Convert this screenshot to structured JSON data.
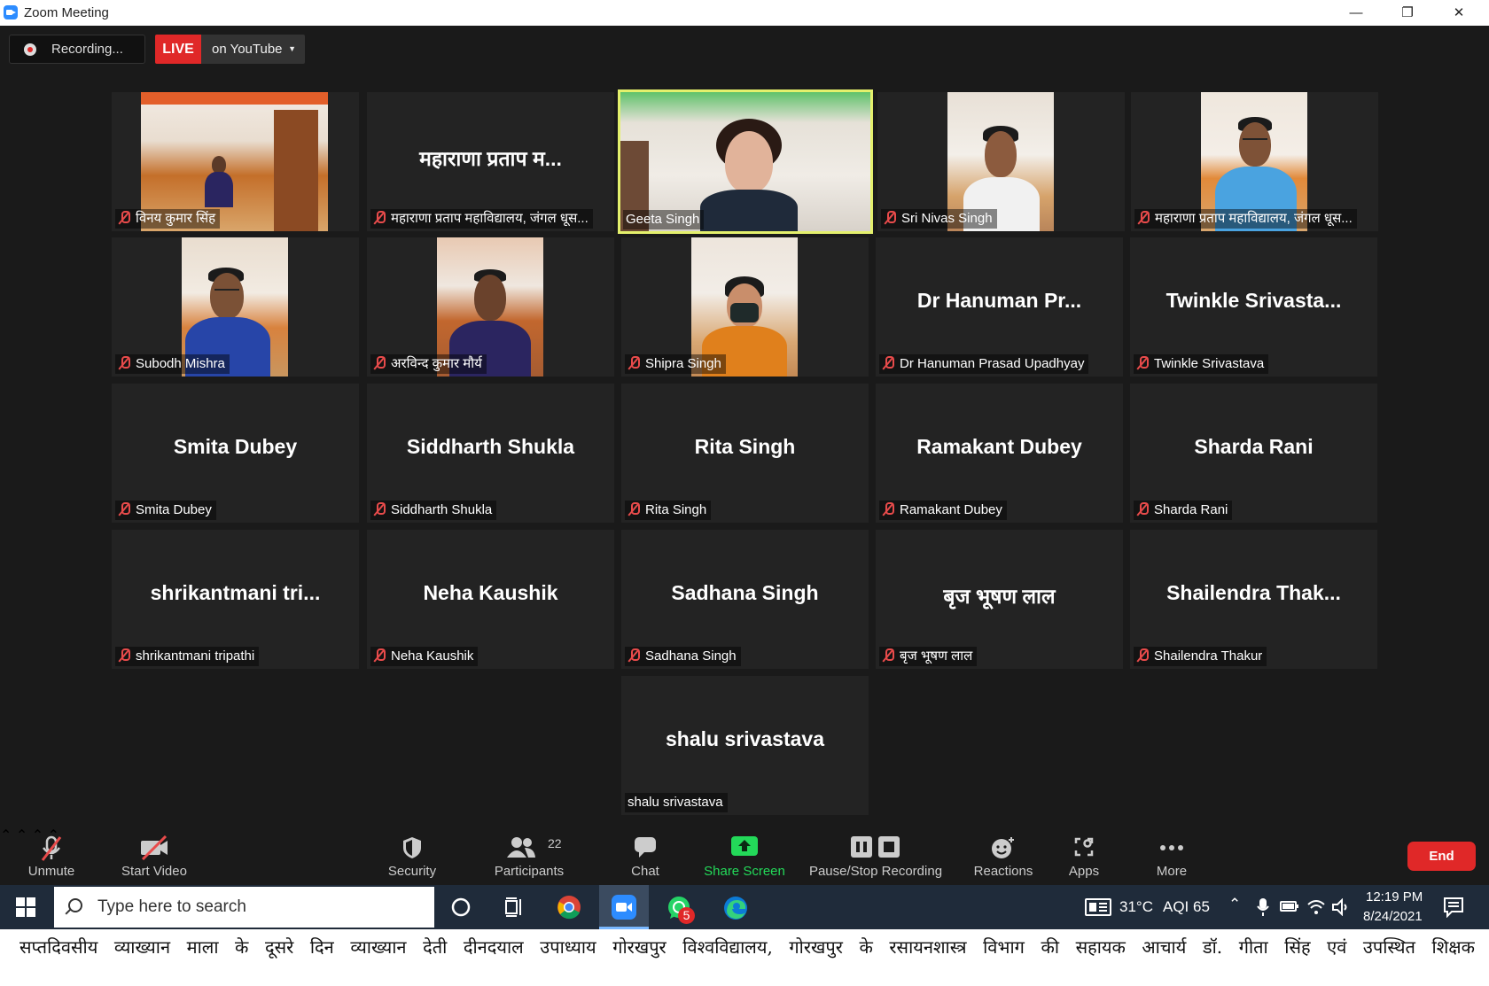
{
  "window": {
    "title": "Zoom Meeting",
    "icon": "zoom-camera-icon",
    "controls": [
      "minimize-icon",
      "restore-icon",
      "close-icon"
    ]
  },
  "status": {
    "recording_label": "Recording...",
    "live_label": "LIVE",
    "live_target": "on YouTube"
  },
  "tiles": [
    {
      "display": "",
      "name": "विनय कुमार सिंह",
      "muted": true,
      "video": true
    },
    {
      "display": "महाराणा प्रताप म...",
      "name": "महाराणा प्रताप महाविद्यालय, जंगल धूस...",
      "muted": true,
      "video": false
    },
    {
      "display": "",
      "name": "Geeta Singh",
      "muted": false,
      "video": true,
      "active_speaker": true
    },
    {
      "display": "",
      "name": "Sri Nivas Singh",
      "muted": true,
      "video": true
    },
    {
      "display": "",
      "name": "महाराणा प्रताप महाविद्यालय, जंगल धूस...",
      "muted": true,
      "video": true
    },
    {
      "display": "",
      "name": "Subodh Mishra",
      "muted": true,
      "video": true
    },
    {
      "display": "",
      "name": "अरविन्द कुमार मौर्य",
      "muted": true,
      "video": true
    },
    {
      "display": "",
      "name": "Shipra Singh",
      "muted": true,
      "video": true
    },
    {
      "display": "Dr Hanuman Pr...",
      "name": "Dr Hanuman Prasad Upadhyay",
      "muted": true,
      "video": false
    },
    {
      "display": "Twinkle  Srivasta...",
      "name": "Twinkle Srivastava",
      "muted": true,
      "video": false
    },
    {
      "display": "Smita Dubey",
      "name": "Smita Dubey",
      "muted": true,
      "video": false
    },
    {
      "display": "Siddharth Shukla",
      "name": "Siddharth Shukla",
      "muted": true,
      "video": false
    },
    {
      "display": "Rita Singh",
      "name": "Rita Singh",
      "muted": true,
      "video": false
    },
    {
      "display": "Ramakant Dubey",
      "name": "Ramakant Dubey",
      "muted": true,
      "video": false
    },
    {
      "display": "Sharda Rani",
      "name": "Sharda Rani",
      "muted": true,
      "video": false
    },
    {
      "display": "shrikantmani  tri...",
      "name": "shrikantmani tripathi",
      "muted": true,
      "video": false
    },
    {
      "display": "Neha Kaushik",
      "name": "Neha Kaushik",
      "muted": true,
      "video": false
    },
    {
      "display": "Sadhana Singh",
      "name": "Sadhana Singh",
      "muted": true,
      "video": false
    },
    {
      "display": "बृज भूषण लाल",
      "name": "बृज भूषण लाल",
      "muted": true,
      "video": false
    },
    {
      "display": "Shailendra  Thak...",
      "name": "Shailendra Thakur",
      "muted": true,
      "video": false
    },
    {
      "display": "shalu srivastava",
      "name": "shalu srivastava",
      "muted": false,
      "video": false
    }
  ],
  "toolbar": {
    "unmute": "Unmute",
    "start_video": "Start Video",
    "security": "Security",
    "participants": "Participants",
    "participants_count": "22",
    "chat": "Chat",
    "share_screen": "Share Screen",
    "pause_stop_recording": "Pause/Stop Recording",
    "reactions": "Reactions",
    "apps": "Apps",
    "more": "More",
    "end": "End",
    "share_color": "#23d959",
    "end_color": "#e02828"
  },
  "taskbar": {
    "search_placeholder": "Type here to search",
    "whatsapp_badge": "5",
    "weather": "31°C",
    "aqi": "AQI 65",
    "time": "12:19 PM",
    "date": "8/24/2021",
    "pinned_apps": [
      "cortana-icon",
      "task-view-icon",
      "chrome-icon",
      "zoom-icon",
      "whatsapp-icon",
      "edge-icon"
    ]
  },
  "caption": "सप्तदिवसीय व्याख्यान माला के दूसरे दिन व्याख्यान देती दीनदयाल उपाध्याय गोरखपुर विश्वविद्यालय, गोरखपुर के रसायनशास्त्र विभाग की सहायक आचार्य डॉ. गीता सिंह एवं उपस्थित शिक्षक"
}
